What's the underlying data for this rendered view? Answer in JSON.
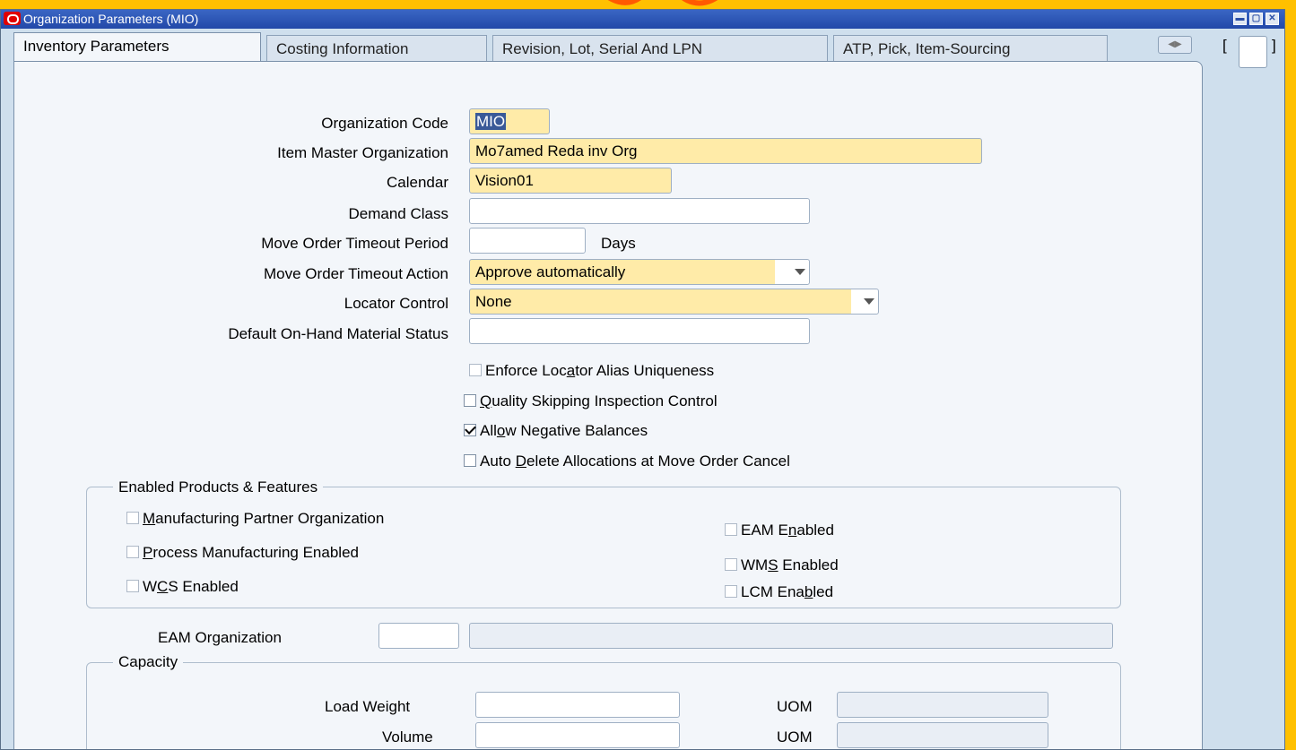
{
  "window": {
    "title": "Organization Parameters (MIO)"
  },
  "tabs": [
    {
      "label": "Inventory Parameters",
      "active": true
    },
    {
      "label": "Costing Information"
    },
    {
      "label": "Revision, Lot, Serial And LPN"
    },
    {
      "label": "ATP, Pick, Item-Sourcing"
    }
  ],
  "tab_bracket_open": "[",
  "tab_bracket_close": "]",
  "form": {
    "organization_code_label": "Organization Code",
    "organization_code_value": "MIO",
    "item_master_label": "Item Master Organization",
    "item_master_value": "Mo7amed Reda inv Org",
    "calendar_label": "Calendar",
    "calendar_value": "Vision01",
    "demand_class_label": "Demand Class",
    "demand_class_value": "",
    "move_order_timeout_period_label": "Move Order Timeout Period",
    "move_order_timeout_period_value": "",
    "days_label": "Days",
    "move_order_timeout_action_label": "Move Order Timeout Action",
    "move_order_timeout_action_value": "Approve automatically",
    "locator_control_label": "Locator Control",
    "locator_control_value": "None",
    "default_onhand_status_label": "Default On-Hand Material Status",
    "default_onhand_status_value": ""
  },
  "checkboxes": [
    {
      "pre": "Enforce Loc",
      "ul": "a",
      "post": "tor Alias Uniqueness",
      "checked": false
    },
    {
      "pre": "",
      "ul": "Q",
      "post": "uality Skipping Inspection Control",
      "checked": false
    },
    {
      "pre": "All",
      "ul": "o",
      "post": "w Negative Balances",
      "checked": true
    },
    {
      "pre": "Auto ",
      "ul": "D",
      "post": "elete Allocations at Move Order Cancel",
      "checked": false
    }
  ],
  "enabled_products": {
    "title": "Enabled Products & Features",
    "left": [
      {
        "pre": "",
        "ul": "M",
        "post": "anufacturing Partner Organization"
      },
      {
        "pre": "",
        "ul": "P",
        "post": "rocess Manufacturing Enabled"
      },
      {
        "pre": "W",
        "ul": "C",
        "post": "S Enabled"
      }
    ],
    "right": [
      {
        "pre": "EAM E",
        "ul": "n",
        "post": "abled"
      },
      {
        "pre": "WM",
        "ul": "S",
        "post": " Enabled"
      },
      {
        "pre": "LCM Ena",
        "ul": "b",
        "post": "led"
      }
    ]
  },
  "eam_organization_label": "EAM Organization",
  "capacity": {
    "title": "Capacity",
    "load_weight_label": "Load Weight",
    "volume_label": "Volume",
    "uom_label": "UOM"
  },
  "colors": {
    "background": "#ffc000",
    "required_field": "#ffeba8",
    "title_bar": "#2248a8"
  }
}
